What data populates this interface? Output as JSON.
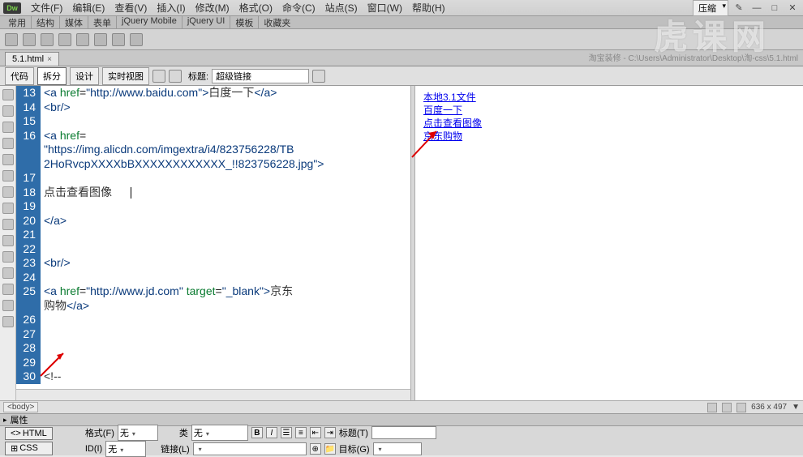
{
  "menubar": [
    "文件(F)",
    "编辑(E)",
    "查看(V)",
    "插入(I)",
    "修改(M)",
    "格式(O)",
    "命令(C)",
    "站点(S)",
    "窗口(W)",
    "帮助(H)"
  ],
  "compress": "压缩",
  "toolbar2": [
    "常用",
    "结构",
    "媒体",
    "表单",
    "jQuery Mobile",
    "jQuery UI",
    "模板",
    "收藏夹"
  ],
  "doc_tab": "5.1.html",
  "doc_path": "淘宝装修 - C:\\Users\\Administrator\\Desktop\\淘-css\\5.1.html",
  "viewbar": {
    "code": "代码",
    "split": "拆分",
    "design": "设计",
    "live": "实时视图",
    "title_label": "标题:",
    "title_value": "超级链接"
  },
  "code": {
    "lines": [
      {
        "n": 13,
        "html": "<span class='tag'>&lt;a</span> <span class='attr'>href</span>=<span class='str'>\"http://www.baidu.com\"</span><span class='tag'>&gt;</span><span class='txt'>白度一下</span><span class='tag'>&lt;/a&gt;</span>"
      },
      {
        "n": 14,
        "html": "<span class='tag'>&lt;br/&gt;</span>"
      },
      {
        "n": 15,
        "html": ""
      },
      {
        "n": 16,
        "html": "<span class='tag'>&lt;a</span> <span class='attr'>href</span>="
      },
      {
        "n": null,
        "html": "<span class='str'>\"https://img.alicdn.com/imgextra/i4/823756228/TB</span>"
      },
      {
        "n": null,
        "html": "<span class='str'>2HoRvcpXXXXbBXXXXXXXXXXXX_!!823756228.jpg\"</span><span class='tag'>&gt;</span>"
      },
      {
        "n": 17,
        "html": ""
      },
      {
        "n": 18,
        "html": "<span class='txt'>点击查看图像</span>      <span class='cursor'></span>"
      },
      {
        "n": 19,
        "html": ""
      },
      {
        "n": 20,
        "html": "<span class='tag'>&lt;/a&gt;</span>"
      },
      {
        "n": 21,
        "html": ""
      },
      {
        "n": 22,
        "html": ""
      },
      {
        "n": 23,
        "html": "<span class='tag'>&lt;br/&gt;</span>"
      },
      {
        "n": 24,
        "html": ""
      },
      {
        "n": 25,
        "html": "<span class='tag'>&lt;a</span> <span class='attr'>href</span>=<span class='str'>\"http://www.jd.com\"</span> <span class='attr'>target</span>=<span class='str'>\"_blank\"</span><span class='tag'>&gt;</span><span class='txt'>京东</span>"
      },
      {
        "n": null,
        "html": "<span class='txt'>购物</span><span class='tag'>&lt;/a&gt;</span>"
      },
      {
        "n": 26,
        "html": ""
      },
      {
        "n": 27,
        "html": ""
      },
      {
        "n": 28,
        "html": ""
      },
      {
        "n": 29,
        "html": ""
      },
      {
        "n": 30,
        "html": "<span class='txt'>&lt;!--</span>"
      }
    ]
  },
  "preview_links": [
    "本地3.1文件",
    "百度一下",
    "点击查看图像",
    "京东购物"
  ],
  "status": {
    "path": "<body>",
    "size": "636 x 497",
    "arrow": "▼"
  },
  "props": {
    "header": "属性",
    "html_btn": "HTML",
    "css_btn": "CSS",
    "format_label": "格式(F)",
    "format_value": "无",
    "id_label": "ID(I)",
    "id_value": "无",
    "class_label": "类",
    "class_value": "无",
    "link_label": "链接(L)",
    "link_value": "",
    "title_label": "标题(T)",
    "target_label": "目标(G)"
  },
  "watermark": "虎课网"
}
